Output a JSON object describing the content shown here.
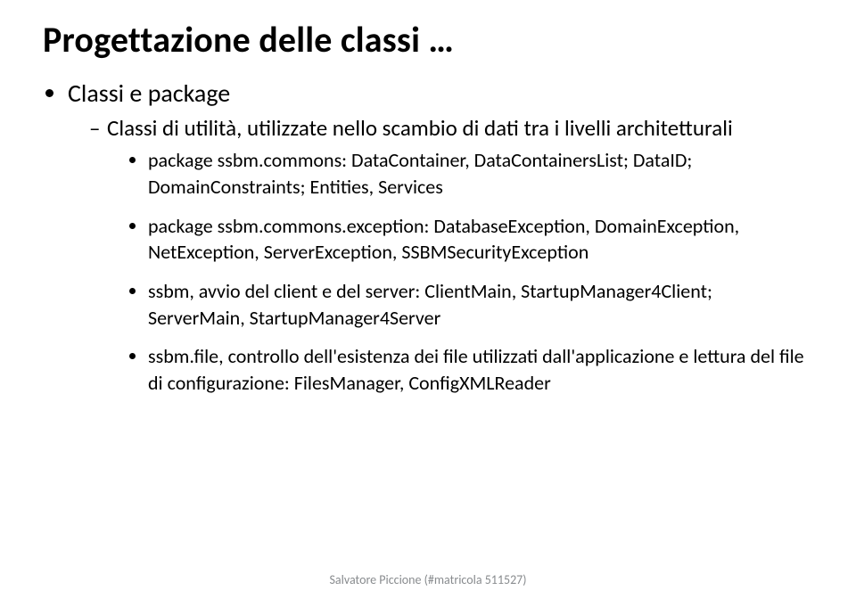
{
  "title": "Progettazione delle classi …",
  "bullets": {
    "l1": "Classi e package",
    "l2": "Classi di utilità, utilizzate nello scambio di dati tra i livelli architetturali",
    "l3": {
      "item1": "package ssbm.commons: DataContainer, DataContainersList; DataID; DomainConstraints; Entities, Services",
      "item2": "package ssbm.commons.exception: DatabaseException, DomainException, NetException, ServerException, SSBMSecurityException",
      "item3": "ssbm, avvio del client e del server: ClientMain, StartupManager4Client; ServerMain, StartupManager4Server",
      "item4": "ssbm.file, controllo dell'esistenza dei file utilizzati dall'applicazione e lettura del file di configurazione: FilesManager, ConfigXMLReader"
    }
  },
  "footer": "Salvatore Piccione (#matricola 511527)"
}
